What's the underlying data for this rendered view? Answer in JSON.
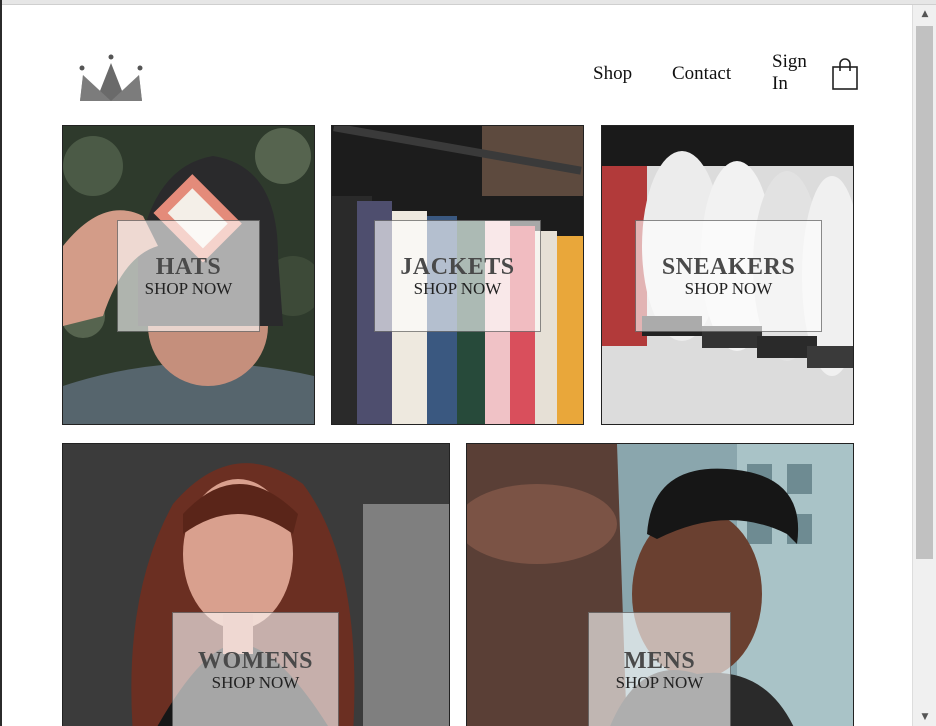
{
  "nav": {
    "shop": "Shop",
    "contact": "Contact",
    "sign_in": "Sign In"
  },
  "icons": {
    "logo": "crown-icon",
    "bag": "shopping-bag-icon",
    "scroll_up": "chevron-up-icon",
    "scroll_down": "chevron-down-icon"
  },
  "categories": [
    {
      "title": "HATS",
      "subtitle": "SHOP NOW"
    },
    {
      "title": "JACKETS",
      "subtitle": "SHOP NOW"
    },
    {
      "title": "SNEAKERS",
      "subtitle": "SHOP NOW"
    },
    {
      "title": "WOMENS",
      "subtitle": "SHOP NOW"
    },
    {
      "title": "MENS",
      "subtitle": "SHOP NOW"
    }
  ],
  "colors": {
    "logo": "#5f5f5f",
    "caption_bg": "#ffffff",
    "caption_title": "#4a4a4a"
  }
}
